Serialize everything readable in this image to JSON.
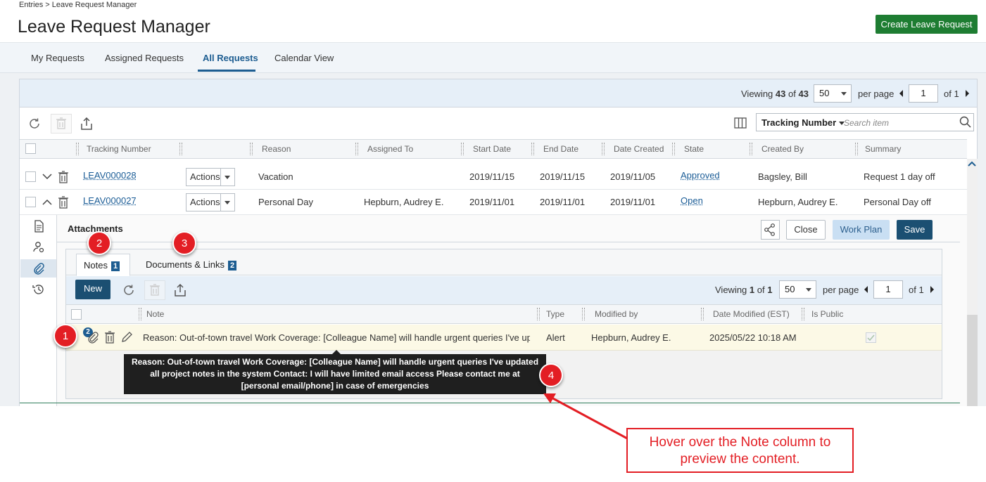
{
  "breadcrumb": "Entries > Leave Request Manager",
  "page_title": "Leave Request Manager",
  "create_button": "Create Leave Request",
  "tabs": [
    {
      "label": "My Requests"
    },
    {
      "label": "Assigned Requests"
    },
    {
      "label": "All Requests",
      "active": true
    },
    {
      "label": "Calendar View"
    }
  ],
  "viewing": {
    "prefix": "Viewing",
    "count": "43",
    "of": "of",
    "total": "43",
    "per_page_value": "50",
    "per_page_label": "per page",
    "page": "1",
    "of_pages": "of 1"
  },
  "search": {
    "field": "Tracking Number",
    "placeholder": "Search item"
  },
  "columns": [
    "Tracking Number",
    "Reason",
    "Assigned To",
    "Start Date",
    "End Date",
    "Date Created",
    "State",
    "Created By",
    "Summary"
  ],
  "rows": [
    {
      "tracking": "LEAV000028",
      "actions": "Actions",
      "reason": "Vacation",
      "assigned": "",
      "start": "2019/11/15",
      "end": "2019/11/15",
      "created": "2019/11/05",
      "state": "Approved",
      "created_by": "Bagsley, Bill",
      "summary": "Request 1 day off"
    },
    {
      "tracking": "LEAV000027",
      "actions": "Actions",
      "reason": "Personal Day",
      "assigned": "Hepburn, Audrey E.",
      "start": "2019/11/01",
      "end": "2019/11/01",
      "created": "2019/11/01",
      "state": "Open",
      "created_by": "Hepburn, Audrey E.",
      "summary": "Personal Day off"
    }
  ],
  "detail": {
    "title": "Attachments",
    "close": "Close",
    "work_plan": "Work Plan",
    "save": "Save",
    "notes_tab": "Notes",
    "notes_count": "1",
    "docs_tab": "Documents & Links",
    "docs_count": "2",
    "new_button": "New",
    "viewing": {
      "prefix": "Viewing",
      "count": "1",
      "of": "of",
      "total": "1",
      "per_page_value": "50",
      "per_page_label": "per page",
      "page": "1",
      "of_pages": "of 1"
    },
    "note_columns": [
      "Note",
      "Type",
      "Modified by",
      "Date Modified (EST)",
      "Is Public"
    ],
    "note_row": {
      "attach_count": "2",
      "note": "Reason: Out-of-town travel Work Coverage: [Colleague Name] will handle urgent queries I've upd...",
      "type": "Alert",
      "modified_by": "Hepburn, Audrey E.",
      "date_modified": "2025/05/22 10:18 AM",
      "is_public": true
    }
  },
  "tooltip": "Reason: Out-of-town travel Work Coverage: [Colleague Name] will handle urgent queries I've updated all project notes in the system Contact: I will have limited email access Please contact me at [personal email/phone] in case of emergencies",
  "markers": [
    "1",
    "2",
    "3",
    "4"
  ],
  "callout": "Hover over the Note column to preview the content.",
  "colors": {
    "primary": "#1d5d91",
    "create": "#1e7d32",
    "annotation": "#e31e24",
    "save": "#1b4f72"
  }
}
